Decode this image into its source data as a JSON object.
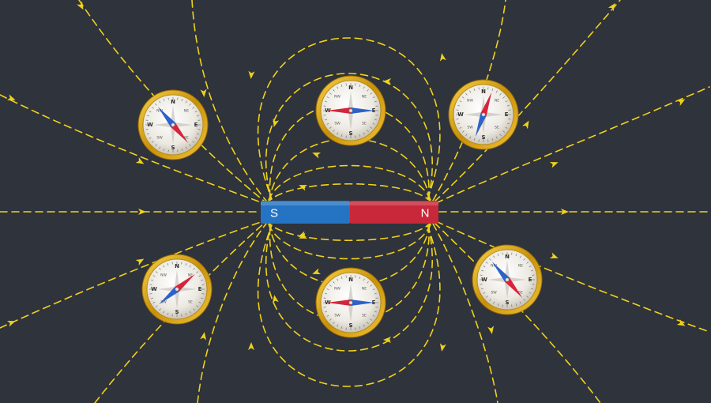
{
  "magnet": {
    "south_label": "S",
    "north_label": "N",
    "south_color": "#2574c4",
    "north_color": "#c8283a"
  },
  "field_line_color": "#f0d21a",
  "background_color": "#2f333b",
  "compass": {
    "labels": {
      "n": "N",
      "s": "S",
      "e": "E",
      "w": "W",
      "ne": "NE",
      "nw": "NW",
      "se": "SE",
      "sw": "SW"
    },
    "needle_north_color": "#d8243a",
    "needle_south_color": "#2d62c8",
    "rim_color": "#d9a510",
    "items": [
      {
        "name": "compass-top-left",
        "needle_angle": 140
      },
      {
        "name": "compass-top-middle",
        "needle_angle": 270
      },
      {
        "name": "compass-top-right",
        "needle_angle": 20
      },
      {
        "name": "compass-bottom-left",
        "needle_angle": 50
      },
      {
        "name": "compass-bottom-middle",
        "needle_angle": 270
      },
      {
        "name": "compass-bottom-right",
        "needle_angle": 140
      }
    ]
  }
}
